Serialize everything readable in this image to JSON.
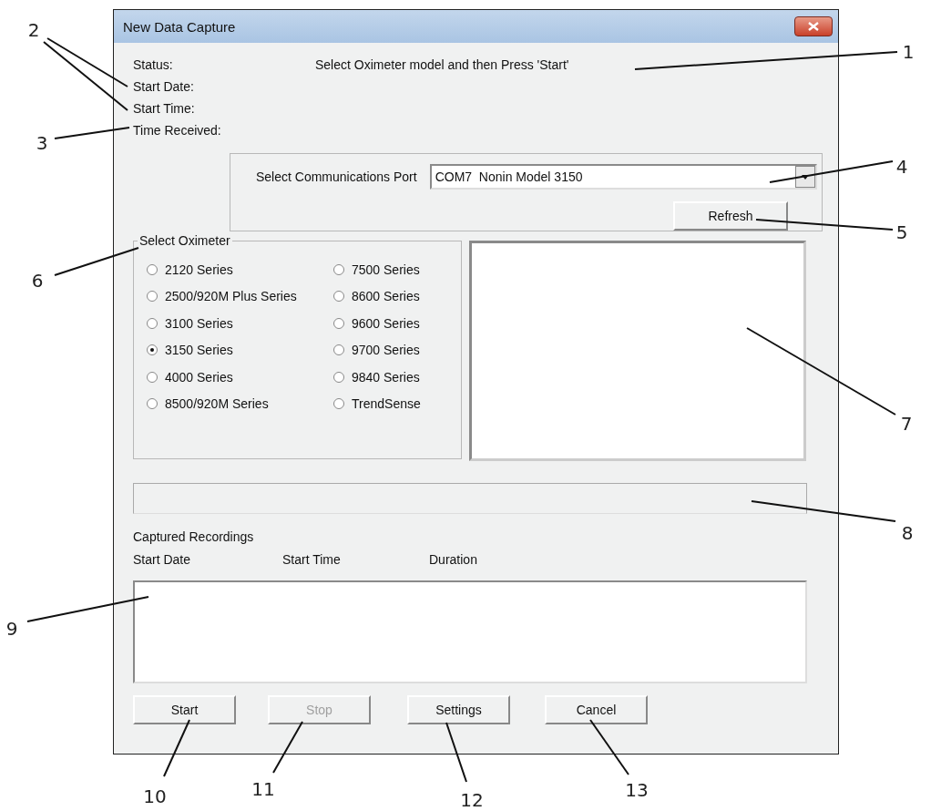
{
  "window": {
    "title": "New Data Capture"
  },
  "status": {
    "label": "Status:",
    "message": "Select Oximeter model and then Press 'Start'"
  },
  "info_labels": [
    "Start Date:",
    "Start Time:",
    "Time Received:"
  ],
  "port": {
    "label": "Select Communications Port",
    "value": "COM7  Nonin Model 3150",
    "refresh_button": "Refresh"
  },
  "oximeter": {
    "title": "Select Oximeter",
    "options": [
      {
        "label": "2120 Series",
        "selected": false
      },
      {
        "label": "7500 Series",
        "selected": false
      },
      {
        "label": "2500/920M Plus Series",
        "selected": false
      },
      {
        "label": "8600 Series",
        "selected": false
      },
      {
        "label": "3100 Series",
        "selected": false
      },
      {
        "label": "9600 Series",
        "selected": false
      },
      {
        "label": "3150 Series",
        "selected": true
      },
      {
        "label": "9700 Series",
        "selected": false
      },
      {
        "label": "4000 Series",
        "selected": false
      },
      {
        "label": "9840 Series",
        "selected": false
      },
      {
        "label": "8500/920M Series",
        "selected": false
      },
      {
        "label": "TrendSense",
        "selected": false
      }
    ]
  },
  "captured": {
    "title": "Captured Recordings",
    "columns": [
      "Start Date",
      "Start Time",
      "Duration"
    ]
  },
  "buttons": [
    {
      "label": "Start",
      "disabled": false
    },
    {
      "label": "Stop",
      "disabled": true
    },
    {
      "label": "Settings",
      "disabled": false
    },
    {
      "label": "Cancel",
      "disabled": false
    }
  ],
  "callouts": [
    "1",
    "2",
    "3",
    "4",
    "5",
    "6",
    "7",
    "8",
    "9",
    "10",
    "11",
    "12",
    "13"
  ]
}
